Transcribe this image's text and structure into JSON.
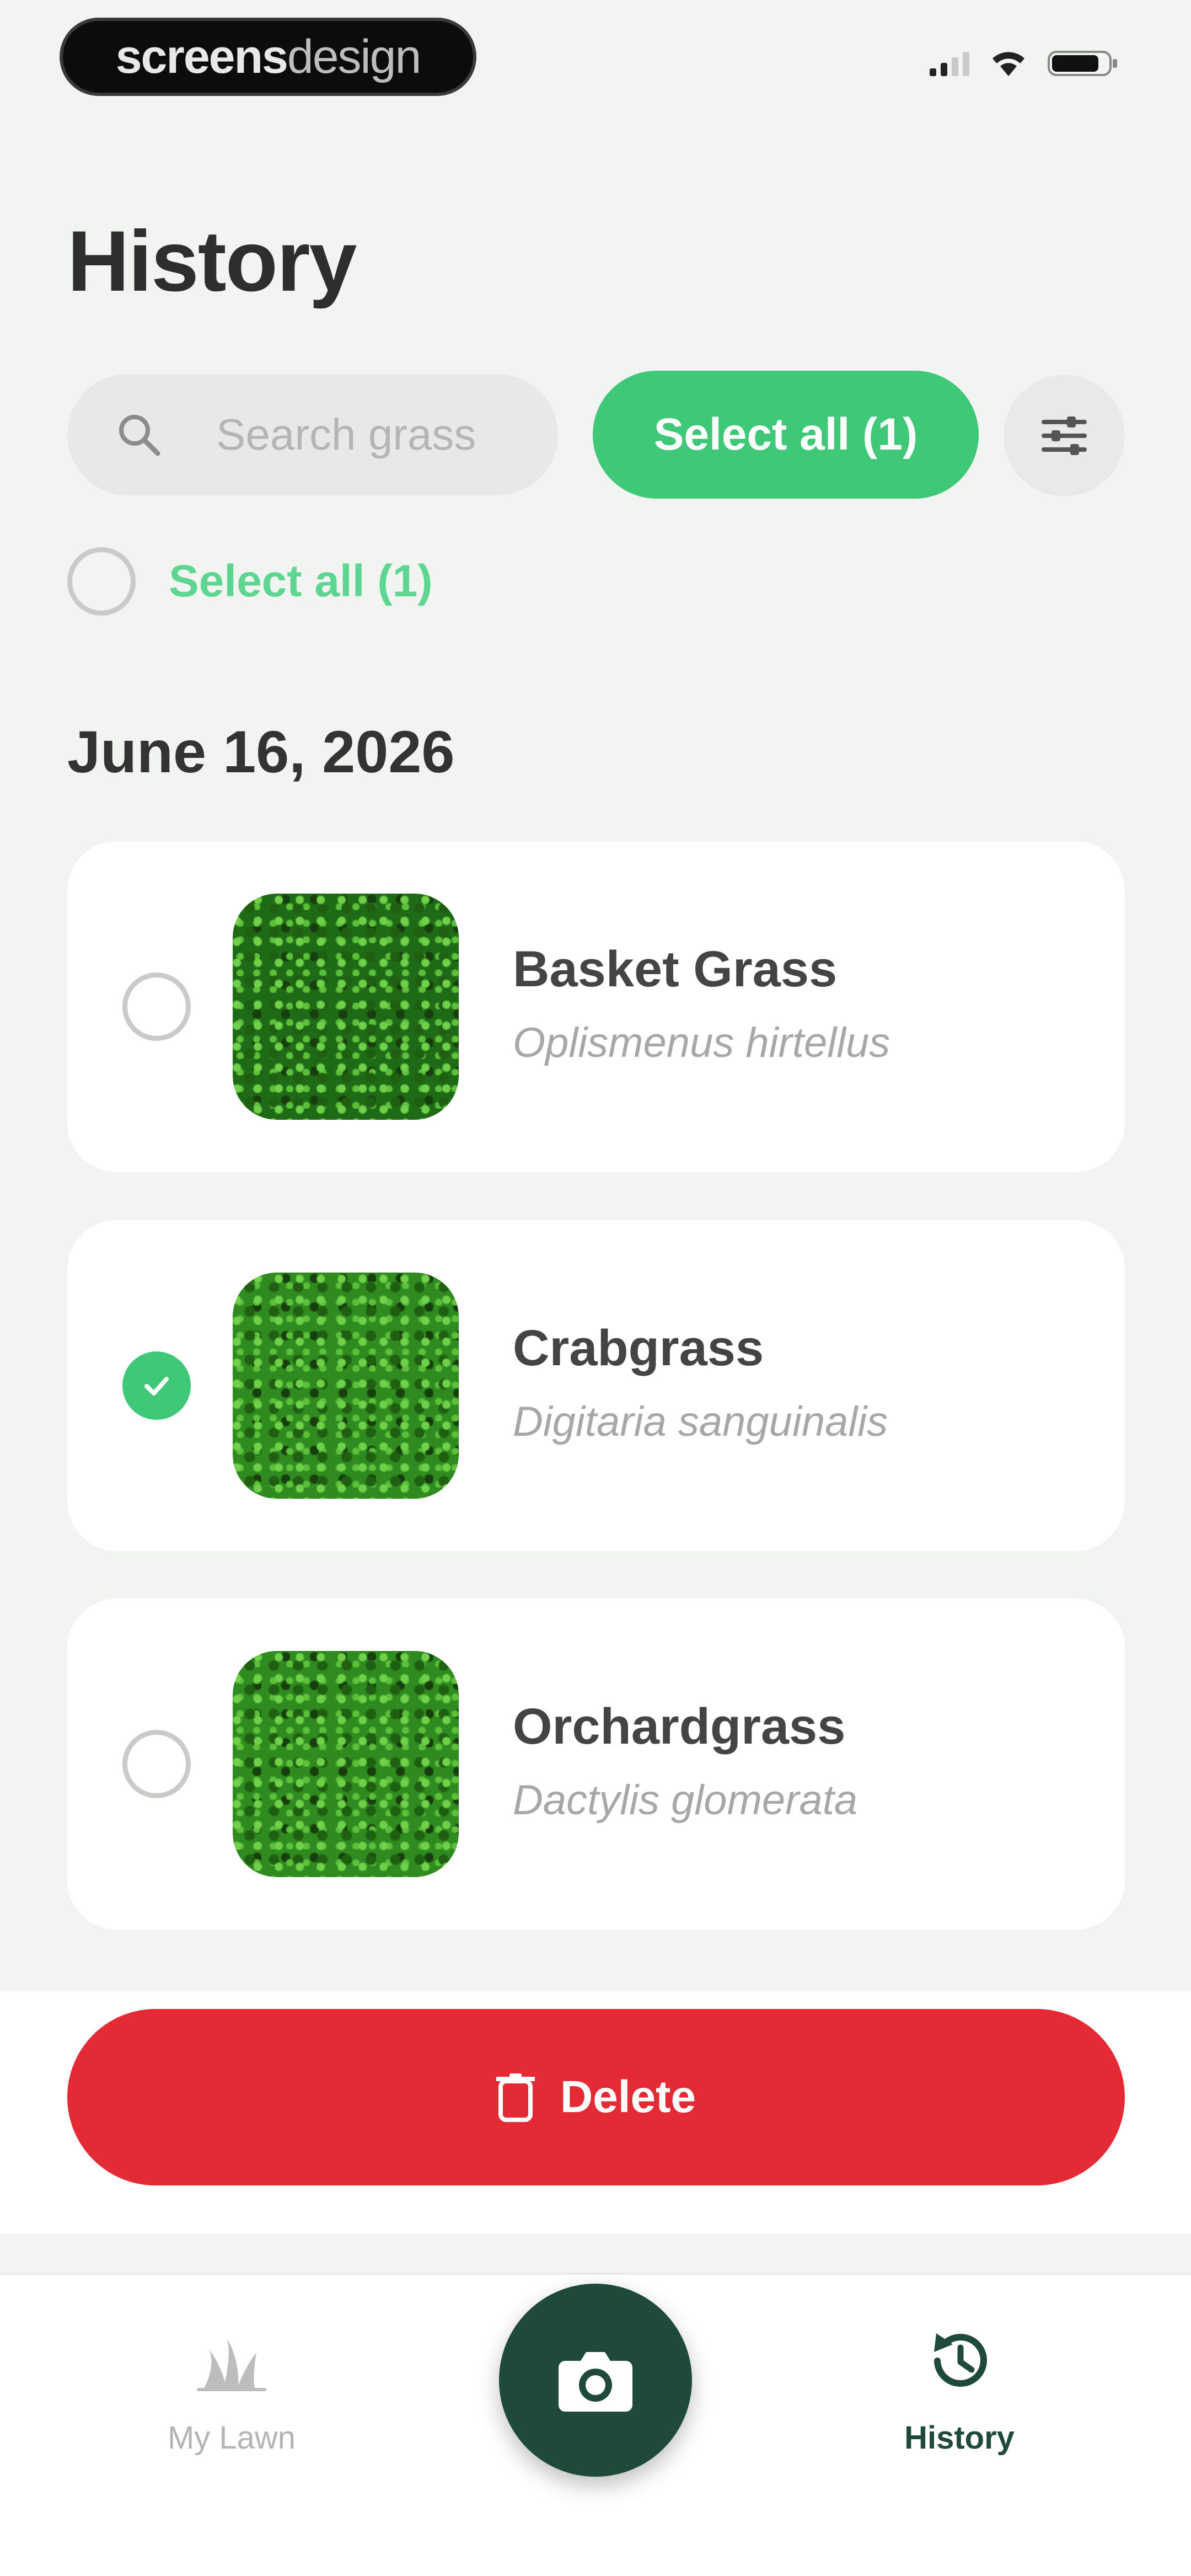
{
  "status_bar": {
    "brand_bold": "screens",
    "brand_light": "design"
  },
  "page": {
    "title": "History"
  },
  "search": {
    "placeholder": "Search grass"
  },
  "toolbar": {
    "select_all_button": "Select all (1)"
  },
  "selection": {
    "select_all_label": "Select all (1)"
  },
  "groups": [
    {
      "date": "June 16, 2026",
      "items": [
        {
          "common_name": "Basket Grass",
          "scientific_name": "Oplismenus hirtellus",
          "selected": false
        },
        {
          "common_name": "Crabgrass",
          "scientific_name": "Digitaria sanguinalis",
          "selected": true
        },
        {
          "common_name": "Orchardgrass",
          "scientific_name": "Dactylis glomerata",
          "selected": false
        }
      ]
    }
  ],
  "actions": {
    "delete_label": "Delete"
  },
  "tabbar": {
    "tabs": [
      {
        "label": "My Lawn",
        "icon": "grass-icon",
        "active": false
      },
      {
        "label": "History",
        "icon": "history-icon",
        "active": true
      }
    ],
    "center_icon": "camera-icon"
  },
  "colors": {
    "accent_green": "#3ec877",
    "danger_red": "#e42a35",
    "dark_green": "#1f4a3a",
    "background": "#f2f4f1"
  }
}
